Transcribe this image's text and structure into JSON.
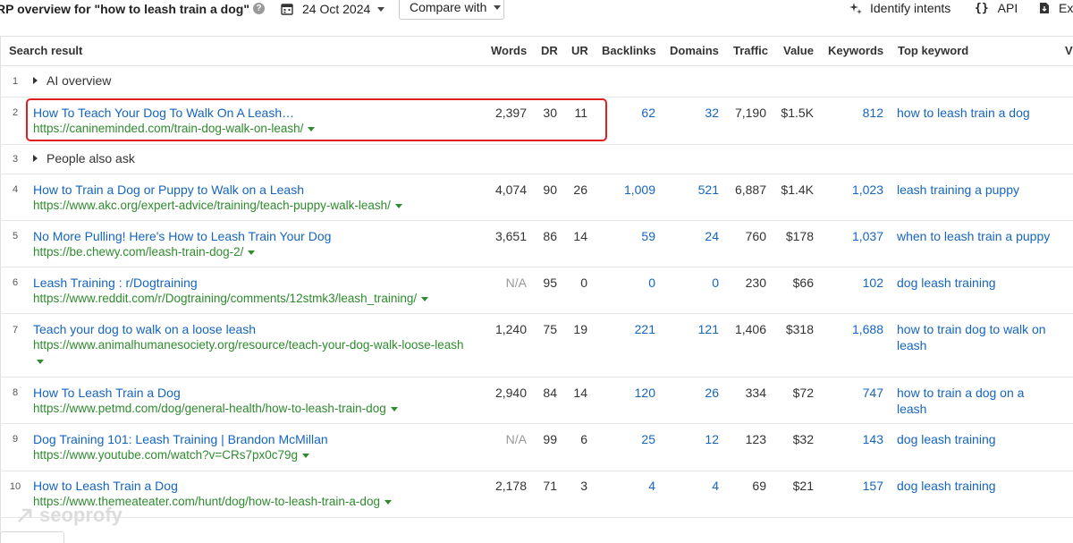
{
  "toolbar": {
    "title": "RP overview for \"how to leash train a dog\"",
    "date": "24 Oct 2024",
    "compare_label": "Compare with",
    "identify_label": "Identify intents",
    "api_label": "API",
    "api_icon": "{}",
    "export_label": "Ex"
  },
  "table": {
    "headers": {
      "result": "Search result",
      "words": "Words",
      "dr": "DR",
      "ur": "UR",
      "backlinks": "Backlinks",
      "domains": "Domains",
      "traffic": "Traffic",
      "value": "Value",
      "keywords": "Keywords",
      "top_keyword": "Top keyword",
      "extra": "V"
    },
    "rows": [
      {
        "num": "1",
        "label": "AI overview"
      },
      {
        "num": "2",
        "title": "How To Teach Your Dog To Walk On A Leash…",
        "url": "https://canineminded.com/train-dog-walk-on-leash/",
        "words": "2,397",
        "dr": "30",
        "ur": "11",
        "backlinks": "62",
        "domains": "32",
        "traffic": "7,190",
        "value": "$1.5K",
        "keywords": "812",
        "top_keyword": "how to leash train a dog"
      },
      {
        "num": "3",
        "label": "People also ask"
      },
      {
        "num": "4",
        "title": "How to Train a Dog or Puppy to Walk on a Leash",
        "url": "https://www.akc.org/expert-advice/training/teach-puppy-walk-leash/",
        "words": "4,074",
        "dr": "90",
        "ur": "26",
        "backlinks": "1,009",
        "domains": "521",
        "traffic": "6,887",
        "value": "$1.4K",
        "keywords": "1,023",
        "top_keyword": "leash training a puppy"
      },
      {
        "num": "5",
        "title": "No More Pulling! Here's How to Leash Train Your Dog",
        "url": "https://be.chewy.com/leash-train-dog-2/",
        "words": "3,651",
        "dr": "86",
        "ur": "14",
        "backlinks": "59",
        "domains": "24",
        "traffic": "760",
        "value": "$178",
        "keywords": "1,037",
        "top_keyword": "when to leash train a puppy"
      },
      {
        "num": "6",
        "title": "Leash Training : r/Dogtraining",
        "url": "https://www.reddit.com/r/Dogtraining/comments/12stmk3/leash_training/",
        "words": "N/A",
        "dr": "95",
        "ur": "0",
        "backlinks": "0",
        "domains": "0",
        "traffic": "230",
        "value": "$66",
        "keywords": "102",
        "top_keyword": "dog leash training"
      },
      {
        "num": "7",
        "title": "Teach your dog to walk on a loose leash",
        "url": "https://www.animalhumanesociety.org/resource/teach-your-dog-walk-loose-leash",
        "words": "1,240",
        "dr": "75",
        "ur": "19",
        "backlinks": "221",
        "domains": "121",
        "traffic": "1,406",
        "value": "$318",
        "keywords": "1,688",
        "top_keyword": "how to train dog to walk on leash"
      },
      {
        "num": "8",
        "title": "How To Leash Train a Dog",
        "url": "https://www.petmd.com/dog/general-health/how-to-leash-train-dog",
        "words": "2,940",
        "dr": "84",
        "ur": "14",
        "backlinks": "120",
        "domains": "26",
        "traffic": "334",
        "value": "$72",
        "keywords": "747",
        "top_keyword": "how to train a dog on a leash"
      },
      {
        "num": "9",
        "title": "Dog Training 101: Leash Training | Brandon McMillan",
        "url": "https://www.youtube.com/watch?v=CRs7px0c79g",
        "words": "N/A",
        "dr": "99",
        "ur": "6",
        "backlinks": "25",
        "domains": "12",
        "traffic": "123",
        "value": "$32",
        "keywords": "143",
        "top_keyword": "dog leash training"
      },
      {
        "num": "10",
        "title": "How to Leash Train a Dog",
        "url": "https://www.themeateater.com/hunt/dog/how-to-leash-train-a-dog",
        "words": "2,178",
        "dr": "71",
        "ur": "3",
        "backlinks": "4",
        "domains": "4",
        "traffic": "69",
        "value": "$21",
        "keywords": "157",
        "top_keyword": "dog leash training"
      }
    ]
  },
  "watermark": "seoprofy",
  "colors": {
    "link": "#1565c0",
    "url": "#2e8b2e",
    "highlight": "#e02020"
  }
}
